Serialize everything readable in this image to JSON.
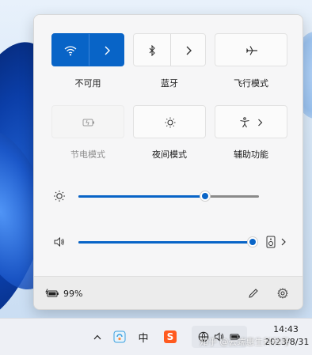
{
  "quick_settings": {
    "tiles": [
      {
        "label": "不可用",
        "icon": "wifi-icon",
        "state": "active"
      },
      {
        "label": "蓝牙",
        "icon": "bluetooth-icon",
        "state": "off"
      },
      {
        "label": "飞行模式",
        "icon": "airplane-icon",
        "state": "off"
      },
      {
        "label": "节电模式",
        "icon": "battery-saver-icon",
        "state": "disabled"
      },
      {
        "label": "夜间模式",
        "icon": "night-light-icon",
        "state": "off"
      },
      {
        "label": "辅助功能",
        "icon": "accessibility-icon",
        "state": "off"
      }
    ],
    "brightness": {
      "icon": "brightness-icon",
      "level": 0.7
    },
    "volume": {
      "icon": "speaker-icon",
      "level": 1.0,
      "output_icon": "speaker-device-icon"
    },
    "footer": {
      "battery_icon": "battery-charging-icon",
      "battery_text": "99%",
      "edit_icon": "pencil-icon",
      "settings_icon": "gear-icon"
    }
  },
  "taskbar": {
    "items": [
      "chevron-up-icon",
      "app-icon",
      "ime-zh-icon",
      "sogou-s-icon",
      "network-icon",
      "volume-icon",
      "battery-icon"
    ],
    "ime_text": "中",
    "sogou_text": "S",
    "clock_time": "14:43",
    "clock_date": "2023/8/31"
  },
  "watermark": "知乎 @云端惠生科科号",
  "colors": {
    "accent": "#0864c7",
    "panel": "#f3f3f3",
    "footer": "#ececec"
  }
}
